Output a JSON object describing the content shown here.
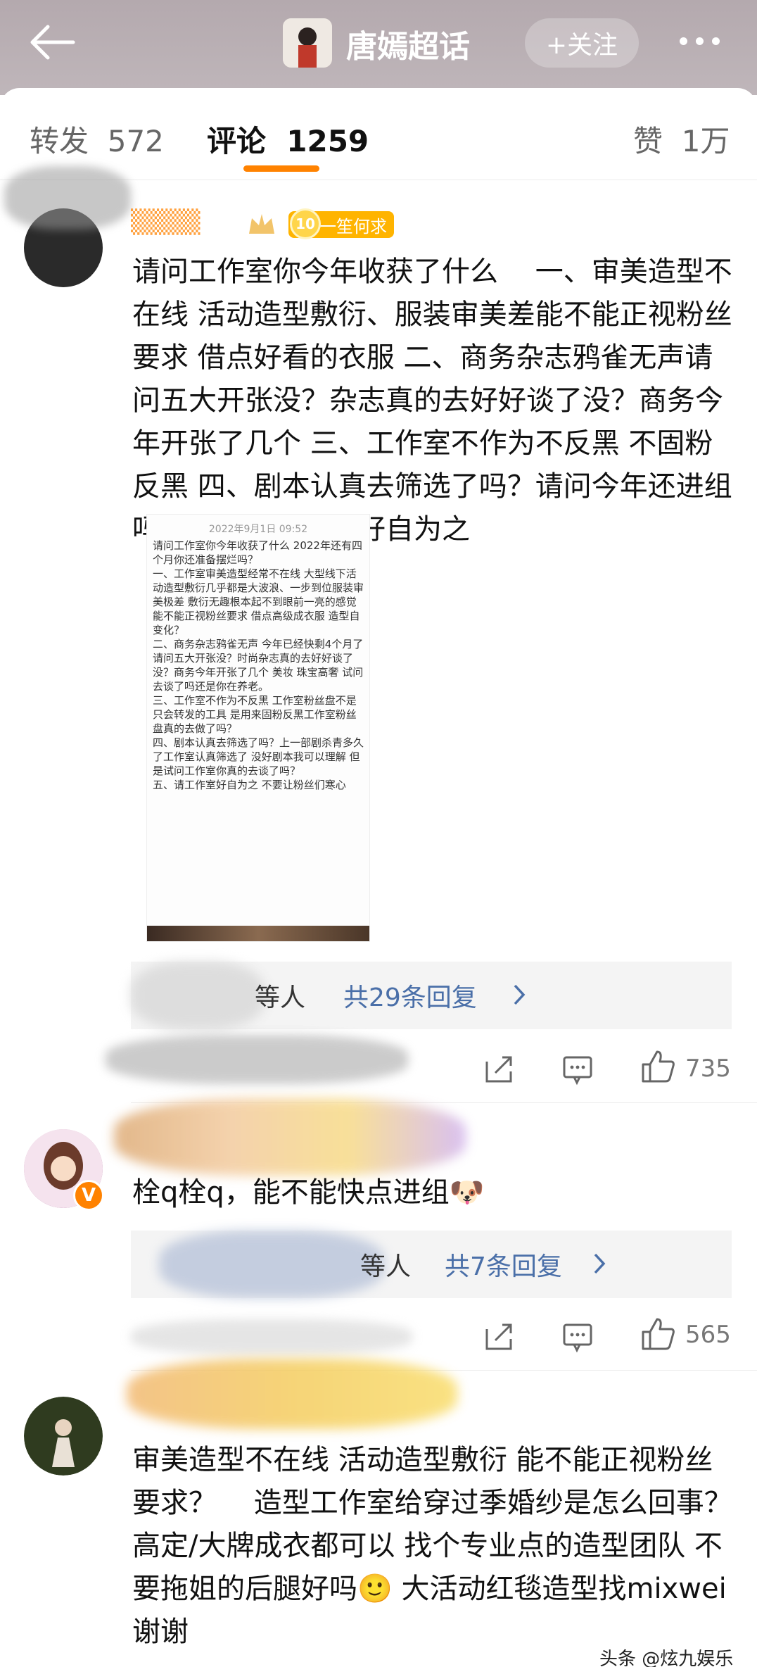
{
  "header": {
    "title": "唐嫣超话",
    "follow_label": "+关注"
  },
  "tabs": {
    "repost_label": "转发",
    "repost_count": "572",
    "comment_label": "评论",
    "comment_count": "1259",
    "like_label": "赞",
    "like_count": "1万"
  },
  "comments": [
    {
      "badge_level": "10",
      "badge_text": "一笙何求",
      "text": "请问工作室你今年收获了什么　 一、审美造型不在线 活动造型敷衍、服装审美差能不能正视粉丝要求 借点好看的衣服 二、商务杂志鸦雀无声请问五大开张没？杂志真的去好好谈了没？商务今年开张了几个 三、工作室不作为不反黑 不固粉反黑 四、剧本认真去筛选了吗？请问今年还进组吗　五、请工作室好自为之",
      "screenshot_date": "2022年9月1日 09:52",
      "screenshot_text": "请问工作室你今年收获了什么 2022年还有四个月你还准备摆烂吗？\n一、工作室审美造型经常不在线 大型线下活动造型敷衍几乎都是大波浪、一步到位服装审美极差 敷衍无趣根本起不到眼前一亮的感觉 能不能正视粉丝要求 借点高级成衣服 造型自变化？\n二、商务杂志鸦雀无声 今年已经快剩4个月了请问五大开张没？时尚杂志真的去好好谈了没？商务今年开张了几个 美妆 珠宝高奢 试问去谈了吗还是你在养老。\n三、工作室不作为不反黑 工作室粉丝盘不是只会转发的工具 是用来固粉反黑工作室粉丝盘真的去做了吗？\n四、剧本认真去筛选了吗？上一部剧杀青多久了工作室认真筛选了 没好剧本我可以理解 但是试问工作室你真的去谈了吗？\n五、请工作室好自为之 不要让粉丝们寒心",
      "reply_suffix": "等人",
      "reply_link": "共29条回复",
      "likes": "735"
    },
    {
      "text": "栓q栓q，能不能快点进组🐶",
      "reply_suffix": "等人",
      "reply_link": "共7条回复",
      "likes": "565"
    },
    {
      "text": "审美造型不在线 活动造型敷衍 能不能正视粉丝要求？　 造型工作室给穿过季婚纱是怎么回事？高定/大牌成衣都可以 找个专业点的造型团队 不要拖姐的后腿好吗🙂 大活动红毯造型找mixwei谢谢"
    }
  ],
  "watermark": "头条 @炫九娱乐",
  "colors": {
    "accent": "#ff8200",
    "link": "#4a6fa8",
    "header_bg": "#b4a9ae"
  }
}
